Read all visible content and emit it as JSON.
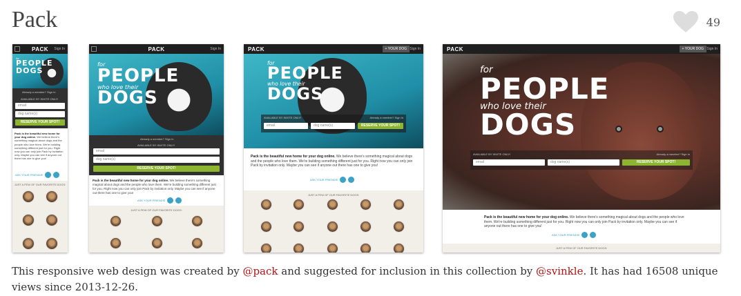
{
  "header": {
    "title": "Pack",
    "like_count": "49",
    "like_icon": "heart-icon"
  },
  "screens": {
    "brand": "PACK",
    "sign_in": "Sign In",
    "hero_small": "for",
    "hero_line1": "PEOPLE",
    "hero_mid": "who love their",
    "hero_line2": "DOGS",
    "already_member": "Already a member? Sign In",
    "invite_only": "AVAILABLE BY INVITE ONLY!",
    "email_placeholder": "email",
    "dog_placeholder": "dog name(s)",
    "cta": "RESERVE YOUR SPOT!",
    "your_dog": "+ YOUR DOG",
    "body_bold": "Pack is the beautiful new home for your dog online.",
    "body_text": "We believe there's something magical about dogs and the people who love them. We're building something different just for you. Right now you can only join Pack by invitation only. Maybe you can see if anyone out there has one to give you!",
    "ask_friends": "ASK YOUR FRIENDS!",
    "favorites": "JUST A FEW OF OUR FAVORITE DOGS:",
    "accent_color": "#8db532",
    "teal_color": "#2fa3b8"
  },
  "caption": {
    "prefix": "This responsive web design was created by ",
    "creator": "@pack",
    "middle": " and suggested for inclusion in this collection by ",
    "suggester": "@svinkle",
    "suffix": ". It has had 16508 unique views since 2013-12-26."
  },
  "colors": {
    "link": "#b01414",
    "heart": "#dddddd"
  }
}
